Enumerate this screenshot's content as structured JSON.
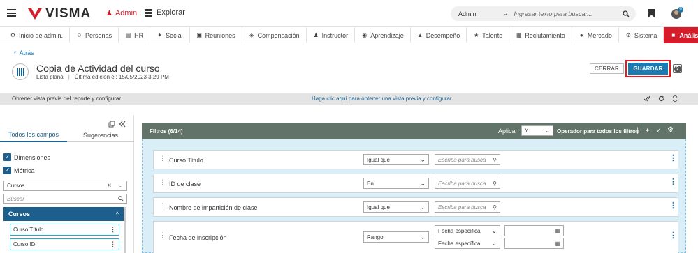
{
  "topbar": {
    "brand": "VISMA",
    "admin_label": "Admin",
    "explore_label": "Explorar",
    "search_scope": "Admin",
    "search_placeholder": "Ingresar texto para buscar...",
    "notif_count": "9"
  },
  "nav": {
    "items": [
      {
        "label": "Inicio de admin.",
        "icon": "admin-home-icon"
      },
      {
        "label": "Personas",
        "icon": "people-icon"
      },
      {
        "label": "HR",
        "icon": "hr-icon"
      },
      {
        "label": "Social",
        "icon": "social-icon"
      },
      {
        "label": "Reuniones",
        "icon": "meetings-icon"
      },
      {
        "label": "Compensación",
        "icon": "compensation-icon"
      },
      {
        "label": "Instructor",
        "icon": "instructor-icon"
      },
      {
        "label": "Aprendizaje",
        "icon": "learning-icon"
      },
      {
        "label": "Desempeño",
        "icon": "performance-icon"
      },
      {
        "label": "Talento",
        "icon": "talent-icon"
      },
      {
        "label": "Reclutamiento",
        "icon": "recruiting-icon"
      },
      {
        "label": "Mercado",
        "icon": "market-icon"
      },
      {
        "label": "Sistema",
        "icon": "system-icon"
      },
      {
        "label": "Análisis",
        "icon": "analytics-icon"
      }
    ],
    "active_index": 13
  },
  "header": {
    "back_label": "Atrás",
    "title": "Copia de Actividad del curso",
    "report_type": "Lista plana",
    "last_edit": "Última edición el: 15/05/2023 3:29 PM",
    "close_label": "CERRAR",
    "save_label": "GUARDAR",
    "help_label": "?"
  },
  "preview": {
    "left_text": "Obtener vista previa del reporte y configurar",
    "center_text": "Haga clic aquí para obtener una vista previa y configurar"
  },
  "left_panel": {
    "tabs": [
      "Todos los campos",
      "Sugerencias"
    ],
    "checkboxes": [
      "Dimensiones",
      "Métrica"
    ],
    "dropdown_value": "Cursos",
    "search_placeholder": "Buscar",
    "group_label": "Cursos",
    "fields": [
      "Curso Título",
      "Curso ID"
    ]
  },
  "filters": {
    "title": "Filtros (6/14)",
    "apply_label": "Aplicar",
    "apply_value": "Y",
    "operator_label": "Operador para todos los filtros",
    "rows": [
      {
        "name": "Curso Título",
        "operator": "Igual que",
        "placeholder": "Escriba para busca"
      },
      {
        "name": "ID de clase",
        "operator": "En",
        "placeholder": "Escriba para busca"
      },
      {
        "name": "Nombre de impartición de clase",
        "operator": "Igual que",
        "placeholder": "Escriba para busca"
      },
      {
        "name": "Fecha de inscripción",
        "operator": "Rango",
        "date_option_1": "Fecha específica",
        "date_option_2": "Fecha específica"
      }
    ]
  },
  "colors": {
    "brand_red": "#d61c2b",
    "primary_blue": "#1c7ab2",
    "filter_header": "#627469",
    "left_group": "#1c5e8c"
  }
}
